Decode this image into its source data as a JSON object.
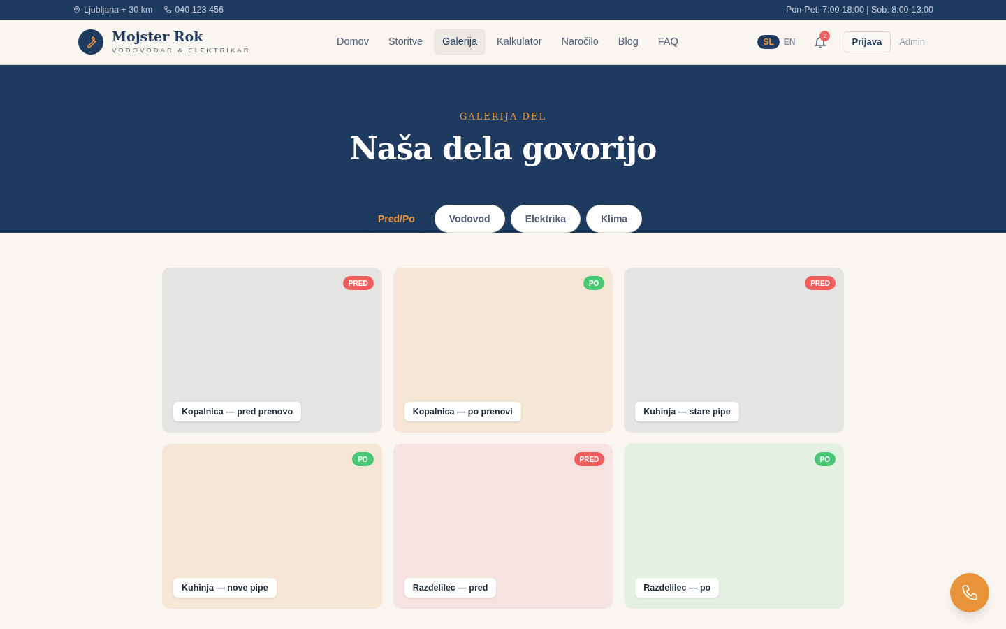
{
  "topbar": {
    "location": "Ljubljana + 30 km",
    "phone": "040 123 456",
    "hours": "Pon-Pet: 7:00-18:00 | Sob: 8:00-13:00"
  },
  "brand": {
    "name": "Mojster Rok",
    "tagline": "VODOVODAR & ELEKTRIKAR"
  },
  "nav": [
    {
      "label": "Domov",
      "selected": false
    },
    {
      "label": "Storitve",
      "selected": false
    },
    {
      "label": "Galerija",
      "selected": true
    },
    {
      "label": "Kalkulator",
      "selected": false
    },
    {
      "label": "Naročilo",
      "selected": false
    },
    {
      "label": "Blog",
      "selected": false
    },
    {
      "label": "FAQ",
      "selected": false
    }
  ],
  "languages": [
    {
      "label": "SL",
      "selected": true
    },
    {
      "label": "EN",
      "selected": false
    }
  ],
  "notifications": {
    "count": "2"
  },
  "login_button": "Prijava",
  "admin_link": "Admin",
  "hero": {
    "eyebrow": "GALERIJA DEL",
    "title": "Naša dela govorijo"
  },
  "filters": [
    {
      "label": "Pred/Po",
      "selected": true
    },
    {
      "label": "Vodovod",
      "selected": false
    },
    {
      "label": "Elektrika",
      "selected": false
    },
    {
      "label": "Klima",
      "selected": false
    }
  ],
  "gallery": [
    {
      "caption": "Kopalnica — pred prenovo",
      "badge": "PRED",
      "kind": "pred",
      "color": "#e4e4e2"
    },
    {
      "caption": "Kopalnica — po prenovi",
      "badge": "PO",
      "kind": "po",
      "color": "#f6e6d6"
    },
    {
      "caption": "Kuhinja — stare pipe",
      "badge": "PRED",
      "kind": "pred",
      "color": "#e4e4e2"
    },
    {
      "caption": "Kuhinja — nove pipe",
      "badge": "PO",
      "kind": "po",
      "color": "#f6e6d6"
    },
    {
      "caption": "Razdelilec — pred",
      "badge": "PRED",
      "kind": "pred",
      "color": "#f6e2e0"
    },
    {
      "caption": "Razdelilec — po",
      "badge": "PO",
      "kind": "po",
      "color": "#e3f0e2"
    }
  ]
}
